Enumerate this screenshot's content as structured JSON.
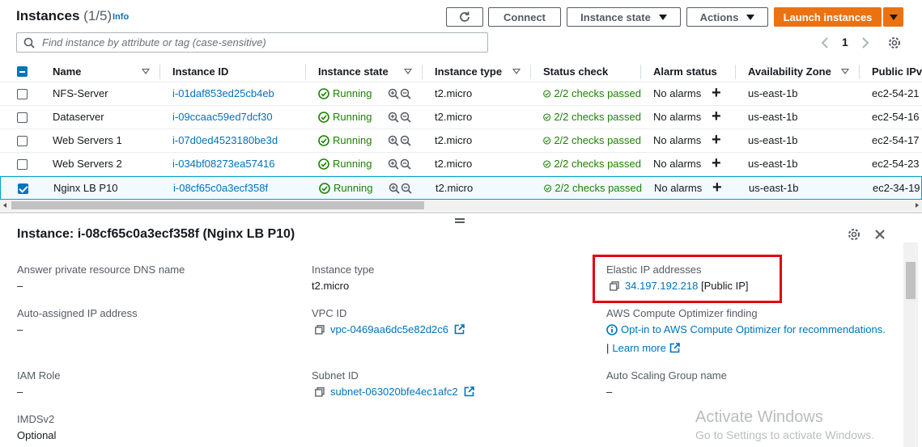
{
  "header": {
    "title": "Instances",
    "count": "(1/5)",
    "info": "Info",
    "buttons": {
      "connect": "Connect",
      "instance_state": "Instance state",
      "actions": "Actions",
      "launch": "Launch instances"
    },
    "search_placeholder": "Find instance by attribute or tag (case-sensitive)",
    "page": "1"
  },
  "table": {
    "columns": [
      "Name",
      "Instance ID",
      "Instance state",
      "Instance type",
      "Status check",
      "Alarm status",
      "Availability Zone",
      "Public IPv"
    ],
    "rows": [
      {
        "name": "NFS-Server",
        "id": "i-01daf853ed25cb4eb",
        "state": "Running",
        "type": "t2.micro",
        "status": "2/2 checks passed",
        "alarm": "No alarms",
        "az": "us-east-1b",
        "public": "ec2-54-21",
        "selected": false
      },
      {
        "name": "Dataserver",
        "id": "i-09ccaac59ed7dcf30",
        "state": "Running",
        "type": "t2.micro",
        "status": "2/2 checks passed",
        "alarm": "No alarms",
        "az": "us-east-1b",
        "public": "ec2-54-16",
        "selected": false
      },
      {
        "name": "Web Servers 1",
        "id": "i-07d0ed4523180be3d",
        "state": "Running",
        "type": "t2.micro",
        "status": "2/2 checks passed",
        "alarm": "No alarms",
        "az": "us-east-1b",
        "public": "ec2-54-17",
        "selected": false
      },
      {
        "name": "Web Servers 2",
        "id": "i-034bf08273ea57416",
        "state": "Running",
        "type": "t2.micro",
        "status": "2/2 checks passed",
        "alarm": "No alarms",
        "az": "us-east-1b",
        "public": "ec2-54-23",
        "selected": false
      },
      {
        "name": "Nginx LB P10",
        "id": "i-08cf65c0a3ecf358f",
        "state": "Running",
        "type": "t2.micro",
        "status": "2/2 checks passed",
        "alarm": "No alarms",
        "az": "us-east-1b",
        "public": "ec2-34-19",
        "selected": true
      }
    ]
  },
  "details": {
    "title": "Instance: i-08cf65c0a3ecf358f (Nginx LB P10)",
    "col1": {
      "dns_label": "Answer private resource DNS name",
      "dns_value": "–",
      "auto_ip_label": "Auto-assigned IP address",
      "auto_ip_value": "–",
      "iam_label": "IAM Role",
      "iam_value": "–",
      "imds_label": "IMDSv2",
      "imds_value": "Optional"
    },
    "col2": {
      "type_label": "Instance type",
      "type_value": "t2.micro",
      "vpc_label": "VPC ID",
      "vpc_value": "vpc-0469aa6dc5e82d2c6",
      "subnet_label": "Subnet ID",
      "subnet_value": "subnet-063020bfe4ec1afc2"
    },
    "col3": {
      "eip_label": "Elastic IP addresses",
      "eip_value": "34.197.192.218",
      "eip_suffix": "[Public IP]",
      "optimizer_label": "AWS Compute Optimizer finding",
      "optimizer_link": "Opt-in to AWS Compute Optimizer for recommendations.",
      "learn_sep": "|",
      "learn_more": "Learn more",
      "asg_label": "Auto Scaling Group name",
      "asg_value": "–"
    }
  },
  "watermark": {
    "line1": "Activate Windows",
    "line2": "Go to Settings to activate Windows."
  },
  "colors": {
    "primary": "#ec7211",
    "link": "#0073bb",
    "success": "#1d8102",
    "highlight": "#e3000f"
  }
}
